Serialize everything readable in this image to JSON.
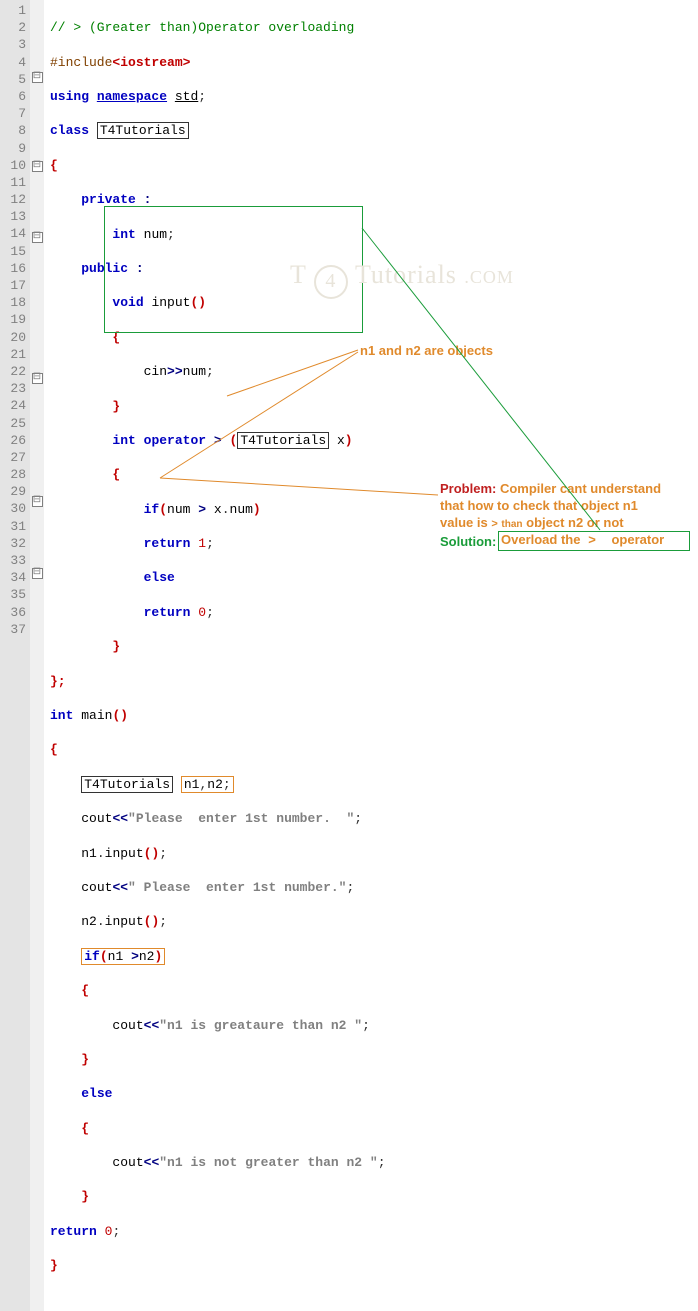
{
  "gutter": [
    "1",
    "2",
    "3",
    "4",
    "5",
    "6",
    "7",
    "8",
    "9",
    "10",
    "11",
    "12",
    "13",
    "14",
    "15",
    "16",
    "17",
    "18",
    "19",
    "20",
    "21",
    "22",
    "23",
    "24",
    "25",
    "26",
    "27",
    "28",
    "29",
    "30",
    "31",
    "32",
    "33",
    "34",
    "35",
    "36",
    "37"
  ],
  "fold": {
    "5": "⊟",
    "10": "⊟",
    "14": "⊟",
    "22": "⊟",
    "29": "⊟",
    "33": "⊟"
  },
  "code": {
    "l1": "// > (Greater than)Operator overloading",
    "l2a": "#include",
    "l2b": "<iostream>",
    "l3a": "using",
    "l3b": "namespace",
    "l3c": "std",
    "l3d": ";",
    "l4a": "class",
    "l4b": "T4Tutorials",
    "l5": "{",
    "l6a": "private",
    "l6b": ":",
    "l7a": "int",
    "l7b": "num",
    "l7c": ";",
    "l8a": "public",
    "l8b": ":",
    "l9a": "void",
    "l9b": "input",
    "l9c": "()",
    "l10": "{",
    "l11a": "cin",
    "l11b": ">>",
    "l11c": "num",
    "l11d": ";",
    "l12": "}",
    "l13a": "int",
    "l13b": "operator",
    "l13c": ">",
    "l13d": "(",
    "l13e": "T4Tutorials",
    "l13f": "x",
    "l13g": ")",
    "l14": "{",
    "l15a": "if",
    "l15b": "(",
    "l15c": "num",
    "l15d": ">",
    "l15e": "x",
    "l15f": ".",
    "l15g": "num",
    "l15h": ")",
    "l16a": "return",
    "l16b": "1",
    "l16c": ";",
    "l17a": "else",
    "l18a": "return",
    "l18b": "0",
    "l18c": ";",
    "l19": "}",
    "l20": "};",
    "l21a": "int",
    "l21b": "main",
    "l21c": "()",
    "l22": "{",
    "l23a": "T4Tutorials",
    "l23b": "n1",
    "l23c": ",",
    "l23d": "n2",
    "l23e": ";",
    "l24a": "cout",
    "l24b": "<<",
    "l24c": "\"Please  enter 1st number.  \"",
    "l24d": ";",
    "l25a": "n1",
    "l25b": ".",
    "l25c": "input",
    "l25d": "()",
    "l25e": ";",
    "l26a": "cout",
    "l26b": "<<",
    "l26c": "\" Please  enter 1st number.\"",
    "l26d": ";",
    "l27a": "n2",
    "l27b": ".",
    "l27c": "input",
    "l27d": "()",
    "l27e": ";",
    "l28a": "if",
    "l28b": "(",
    "l28c": "n1",
    "l28d": ">",
    "l28e": "n2",
    "l28f": ")",
    "l29": "{",
    "l30a": "cout",
    "l30b": "<<",
    "l30c": "\"n1 is greataure than n2 \"",
    "l30d": ";",
    "l31": "}",
    "l32a": "else",
    "l33": "{",
    "l34a": "cout",
    "l34b": "<<",
    "l34c": "\"n1 is not greater than n2 \"",
    "l34d": ";",
    "l35": "}",
    "l36a": "return",
    "l36b": "0",
    "l36c": ";",
    "l37": "}"
  },
  "watermark": {
    "t": "T",
    "num": "4",
    "rest": "Tutorials",
    "dot": ".COM"
  },
  "annotations": {
    "objects": "n1 and n2 are objects",
    "problem_label": "Problem:",
    "problem_text1": "Compiler cant understand",
    "problem_text2": "that how to check that object n1",
    "problem_text3a": "value is",
    "problem_gt": ">",
    "problem_than": "than",
    "problem_text3b": "object n2 or not",
    "solution_label": "Solution:",
    "solution_text1": "Overload the",
    "solution_gt": ">",
    "solution_text2": "operator"
  }
}
